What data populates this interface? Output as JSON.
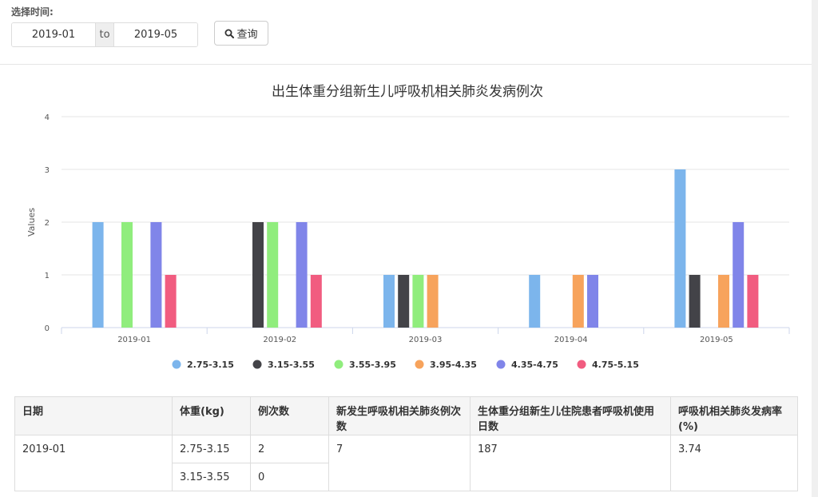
{
  "filter": {
    "label": "选择时间:",
    "from": "2019-01",
    "to_word": "to",
    "to": "2019-05",
    "query_label": "查询"
  },
  "chart_data": {
    "type": "bar",
    "title": "出生体重分组新生儿呼吸机相关肺炎发病例次",
    "xlabel": "",
    "ylabel": "Values",
    "ylim": [
      0,
      4
    ],
    "yticks": [
      "0",
      "1",
      "2",
      "3",
      "4"
    ],
    "grid": true,
    "legend_position": "bottom",
    "categories": [
      "2019-01",
      "2019-02",
      "2019-03",
      "2019-04",
      "2019-05"
    ],
    "series": [
      {
        "name": "2.75-3.15",
        "color": "#7cb5ec",
        "values": [
          2,
          0,
          1,
          1,
          3
        ]
      },
      {
        "name": "3.15-3.55",
        "color": "#434348",
        "values": [
          0,
          2,
          1,
          0,
          1
        ]
      },
      {
        "name": "3.55-3.95",
        "color": "#90ed7d",
        "values": [
          2,
          2,
          1,
          0,
          0
        ]
      },
      {
        "name": "3.95-4.35",
        "color": "#f7a35c",
        "values": [
          0,
          0,
          1,
          1,
          1
        ]
      },
      {
        "name": "4.35-4.75",
        "color": "#8085e9",
        "values": [
          2,
          2,
          0,
          1,
          2
        ]
      },
      {
        "name": "4.75-5.15",
        "color": "#f15c80",
        "values": [
          1,
          1,
          0,
          0,
          1
        ]
      }
    ]
  },
  "table": {
    "headers": {
      "date": "日期",
      "weight": "体重(kg)",
      "count": "例次数",
      "new_cases": "新发生呼吸机相关肺炎例次数",
      "vent_days": "生体重分组新生儿住院患者呼吸机使用日数",
      "rate": "呼吸机相关肺炎发病率(%)"
    },
    "group": {
      "date": "2019-01",
      "new_cases": "7",
      "vent_days": "187",
      "rate": "3.74"
    },
    "rows": [
      {
        "weight": "2.75-3.15",
        "count": "2"
      },
      {
        "weight": "3.15-3.55",
        "count": "0"
      }
    ]
  }
}
